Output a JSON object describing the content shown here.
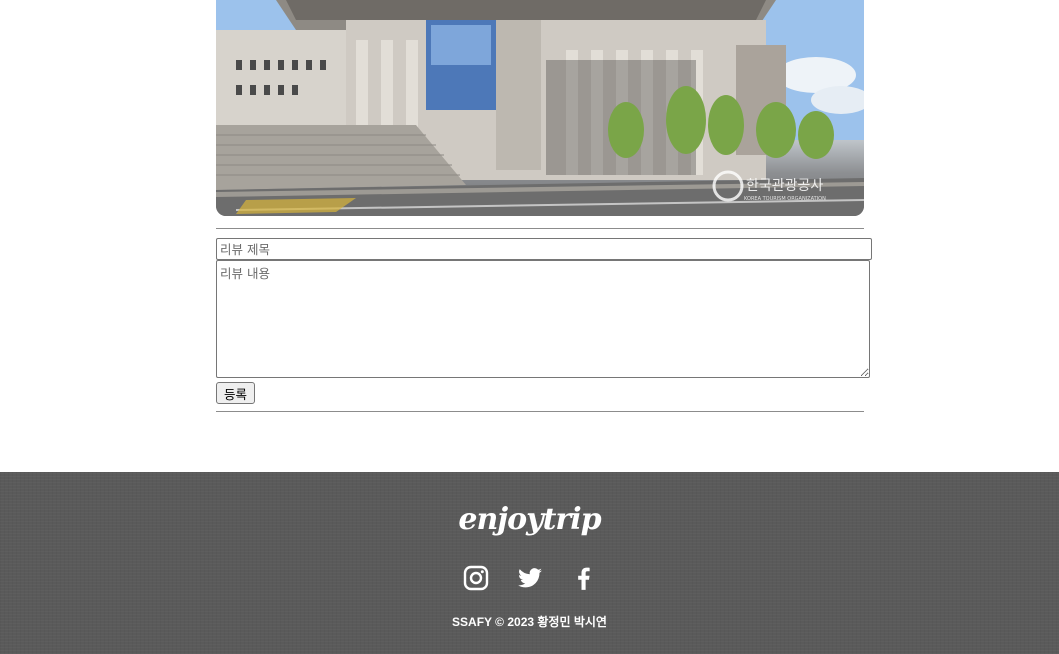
{
  "review_form": {
    "title_placeholder": "리뷰 제목",
    "body_placeholder": "리뷰 내용",
    "submit_label": "등록"
  },
  "hero_image": {
    "watermark": "한국관광공사",
    "watermark_sub": "KOREA TOURISM ORGANIZATION"
  },
  "footer": {
    "logo": "enjoytrip",
    "socials": [
      {
        "icon": "instagram-icon"
      },
      {
        "icon": "twitter-icon"
      },
      {
        "icon": "facebook-icon"
      }
    ],
    "copyright": "SSAFY © 2023 황정민 박시연"
  },
  "colors": {
    "footer_bg": "#5a5a5a",
    "footer_text": "#ffffff",
    "rule": "#8c8c8c"
  }
}
